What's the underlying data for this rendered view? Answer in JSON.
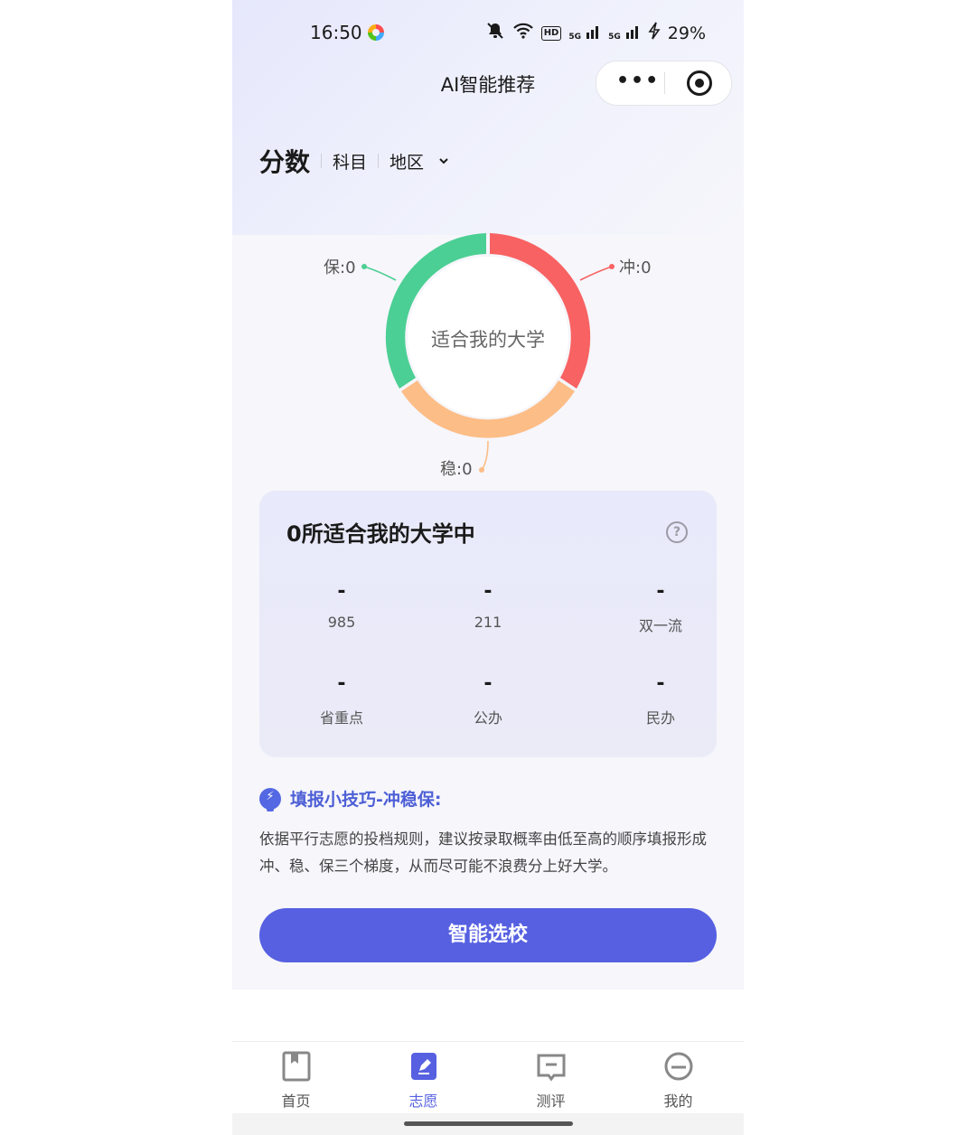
{
  "status_bar": {
    "time": "16:50",
    "battery": "29%",
    "hd_badge": "HD",
    "signal_label": "5G"
  },
  "nav": {
    "title": "AI智能推荐",
    "more_label": "•••"
  },
  "filters": {
    "score": "分数",
    "subject": "科目",
    "region": "地区"
  },
  "donut": {
    "center_label": "适合我的大学",
    "labels": {
      "bao": "保:0",
      "chong": "冲:0",
      "wen": "稳:0"
    },
    "colors": {
      "bao": "#4ccf94",
      "chong": "#f86262",
      "wen": "#fdbd86"
    }
  },
  "stats_card": {
    "title": "0所适合我的大学中",
    "help": "?",
    "items": [
      {
        "value": "-",
        "label": "985"
      },
      {
        "value": "-",
        "label": "211"
      },
      {
        "value": "-",
        "label": "双一流"
      },
      {
        "value": "-",
        "label": "省重点"
      },
      {
        "value": "-",
        "label": "公办"
      },
      {
        "value": "-",
        "label": "民办"
      }
    ]
  },
  "tip": {
    "title": "填报小技巧-冲稳保:",
    "body": "依据平行志愿的投档规则，建议按录取概率由低至高的顺序填报形成冲、稳、保三个梯度，从而尽可能不浪费分上好大学。"
  },
  "action_button": "智能选校",
  "tabbar": {
    "tabs": [
      {
        "label": "首页",
        "icon": "book-icon"
      },
      {
        "label": "志愿",
        "icon": "edit-icon"
      },
      {
        "label": "测评",
        "icon": "assessment-icon"
      },
      {
        "label": "我的",
        "icon": "profile-icon"
      }
    ],
    "active_color": "#5660e1"
  }
}
